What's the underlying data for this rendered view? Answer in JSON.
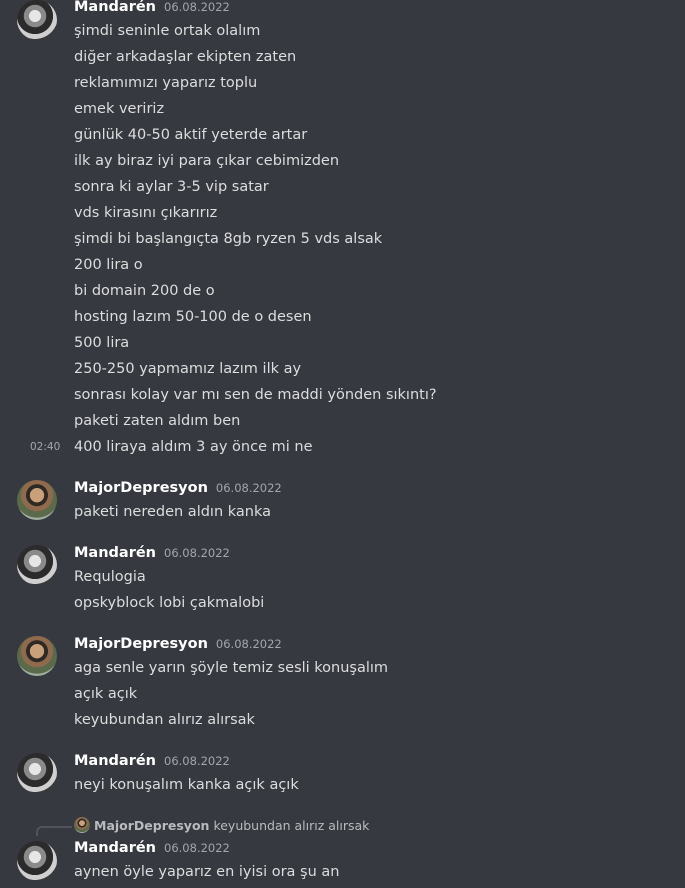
{
  "messages": [
    {
      "author": "Mandarén",
      "date": "06.08.2022",
      "hover_time": "02:40",
      "lines": [
        "şimdi seninle ortak olalım",
        "diğer arkadaşlar ekipten zaten",
        "reklamımızı yaparız toplu",
        "emek veririz",
        "günlük 40-50 aktif yeterde artar",
        "ilk ay biraz iyi para çıkar cebimizden",
        "sonra ki aylar 3-5 vip satar",
        "vds kirasını çıkarırız",
        "şimdi bi başlangıçta 8gb ryzen 5 vds alsak",
        "200 lira o",
        "bi domain 200 de o",
        "hosting lazım 50-100 de o desen",
        "500 lira",
        "250-250 yapmamız lazım ilk ay",
        "sonrası kolay var mı sen de maddi yönden sıkıntı?",
        "paketi zaten aldım ben",
        "400 liraya aldım 3 ay önce mi ne"
      ]
    },
    {
      "author": "MajorDepresyon",
      "date": "06.08.2022",
      "lines": [
        "paketi nereden aldın kanka"
      ]
    },
    {
      "author": "Mandarén",
      "date": "06.08.2022",
      "lines": [
        "Requlogia",
        "opskyblock lobi çakmalobi"
      ]
    },
    {
      "author": "MajorDepresyon",
      "date": "06.08.2022",
      "lines": [
        "aga senle yarın şöyle temiz sesli konuşalım",
        "açık açık",
        "keyubundan alırız alırsak"
      ]
    },
    {
      "author": "Mandarén",
      "date": "06.08.2022",
      "lines": [
        "neyi konuşalım kanka açık açık"
      ]
    },
    {
      "author": "Mandarén",
      "date": "06.08.2022",
      "reply": {
        "author": "MajorDepresyon",
        "text": "keyubundan alırız alırsak"
      },
      "lines": [
        "aynen öyle yaparız en iyisi ora şu an"
      ]
    }
  ]
}
